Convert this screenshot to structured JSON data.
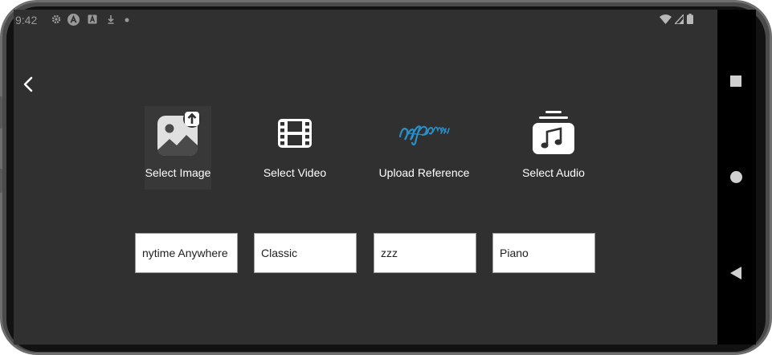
{
  "status_bar": {
    "time": "9:42"
  },
  "options": [
    {
      "label": "Select Image",
      "icon": "image-upload-icon"
    },
    {
      "label": "Select Video",
      "icon": "video-film-icon"
    },
    {
      "label": "Upload Reference",
      "icon": "reference-logo-icon"
    },
    {
      "label": "Select Audio",
      "icon": "music-note-icon"
    }
  ],
  "fields": [
    {
      "value": "nytime Anywhere"
    },
    {
      "value": "Classic"
    },
    {
      "value": "zzz"
    },
    {
      "value": "Piano"
    }
  ],
  "colors": {
    "screen_bg": "#303030",
    "text": "#ffffff",
    "reference_logo": "#2a8fc9"
  }
}
